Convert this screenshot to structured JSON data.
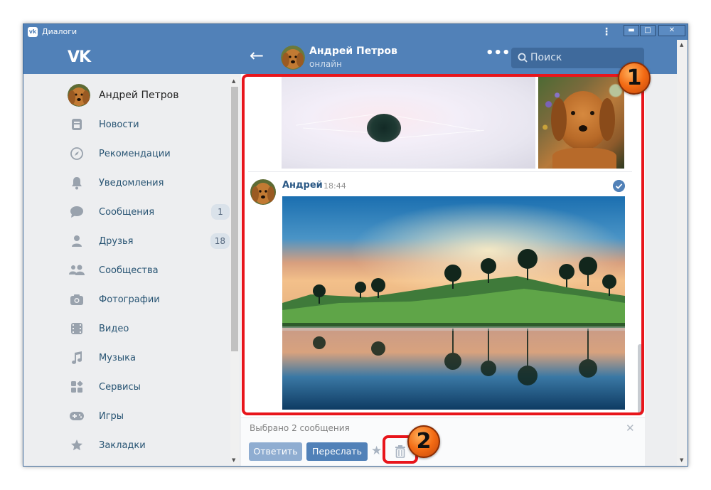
{
  "window": {
    "title": "Диалоги",
    "controls": [
      "▬",
      "□",
      "✕"
    ]
  },
  "header": {
    "logo": "VK",
    "chat_name": "Андрей Петров",
    "chat_status": "онлайн",
    "search_placeholder": "Поиск"
  },
  "sidebar": {
    "profile_name": "Андрей Петров",
    "items": [
      {
        "label": "Новости",
        "icon": "news-icon"
      },
      {
        "label": "Рекомендации",
        "icon": "compass-icon"
      },
      {
        "label": "Уведомления",
        "icon": "bell-icon"
      },
      {
        "label": "Сообщения",
        "icon": "message-icon",
        "count": "1"
      },
      {
        "label": "Друзья",
        "icon": "user-icon",
        "count": "18"
      },
      {
        "label": "Сообщества",
        "icon": "group-icon"
      },
      {
        "label": "Фотографии",
        "icon": "camera-icon"
      },
      {
        "label": "Видео",
        "icon": "film-icon"
      },
      {
        "label": "Музыка",
        "icon": "music-icon"
      },
      {
        "label": "Сервисы",
        "icon": "services-icon"
      },
      {
        "label": "Игры",
        "icon": "gamepad-icon"
      },
      {
        "label": "Закладки",
        "icon": "star-icon"
      }
    ]
  },
  "message": {
    "author": "Андрей",
    "time": "18:44"
  },
  "selection": {
    "text": "Выбрано 2 сообщения",
    "reply_label": "Ответить",
    "forward_label": "Переслать"
  },
  "annotations": {
    "badge1": "1",
    "badge2": "2",
    "highlight_color": "#e8151b"
  },
  "colors": {
    "brand": "#5181b8",
    "link": "#2a5885",
    "background": "#edeef0"
  }
}
